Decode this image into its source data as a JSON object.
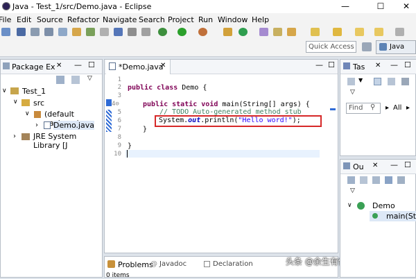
{
  "window": {
    "title": "Java - Test_1/src/Demo.java - Eclipse",
    "controls": [
      "—",
      "☐",
      "✕"
    ]
  },
  "menu": [
    "File",
    "Edit",
    "Source",
    "Refactor",
    "Navigate",
    "Search",
    "Project",
    "Run",
    "Window",
    "Help"
  ],
  "toolbar": {
    "quick_access": "Quick Access",
    "perspective": "Java"
  },
  "package_explorer": {
    "tab": "Package Ex",
    "tree": [
      "Test_1",
      "src",
      "(default package)",
      "Demo.java",
      "JRE System Library [J"
    ]
  },
  "editor": {
    "tab": "*Demo.java",
    "line_numbers": [
      "1",
      "2",
      "3",
      "4⊖",
      "5",
      "6",
      "7",
      "8",
      "9",
      "10"
    ],
    "code": {
      "l3_kw": "public class",
      "l3_rest": " Demo {",
      "l5_kw": "public static void",
      "l5_rest": " main(String[] args) {",
      "l6": "// TODO Auto-generated method stub",
      "l7_a": "System.",
      "l7_b": "out",
      "l7_c": ".println(",
      "l7_d": "\"Hello word!\"",
      "l7_e": ");",
      "l8": "}",
      "l10": "}"
    }
  },
  "task_list": {
    "tab": "Tas",
    "find_placeholder": "Find",
    "all": "All"
  },
  "outline": {
    "tab": "Ou",
    "class": "Demo",
    "method": "main(Strir"
  },
  "bottom": {
    "tabs": [
      "Problems",
      "Javadoc",
      "Declaration"
    ],
    "status": "0 items"
  },
  "watermark": "头条 @余生有你才安好啊",
  "colors": {
    "highlight": "#d62828",
    "selection": "#3875d7",
    "keyword": "#7f0055"
  }
}
